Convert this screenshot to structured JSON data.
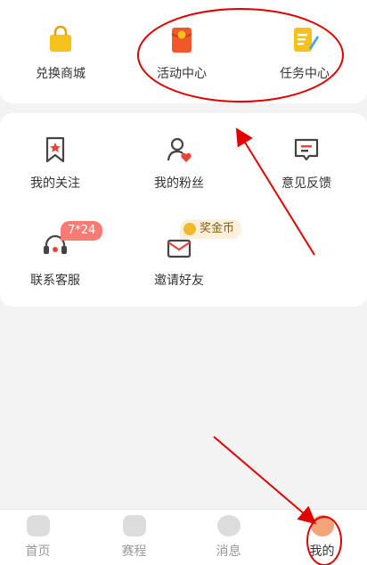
{
  "top_row": [
    {
      "label": "兑换商城",
      "icon": "shopping-bag-icon"
    },
    {
      "label": "活动中心",
      "icon": "red-envelope-icon"
    },
    {
      "label": "任务中心",
      "icon": "task-notepad-icon"
    }
  ],
  "services": [
    {
      "label": "我的关注",
      "icon": "bookmark-star-icon"
    },
    {
      "label": "我的粉丝",
      "icon": "user-heart-icon"
    },
    {
      "label": "意见反馈",
      "icon": "feedback-chat-icon"
    },
    {
      "label": "联系客服",
      "icon": "headset-icon",
      "badge": "7*24"
    },
    {
      "label": "邀请好友",
      "icon": "invite-envelope-icon",
      "badge": "奖金币"
    }
  ],
  "tabbar": [
    {
      "label": "首页",
      "icon": "home-icon"
    },
    {
      "label": "赛程",
      "icon": "trophy-icon"
    },
    {
      "label": "消息",
      "icon": "message-bubble-icon"
    },
    {
      "label": "我的",
      "icon": "profile-avatar-icon",
      "active": true
    }
  ],
  "colors": {
    "accent": "#f26b2c",
    "badge": "#fa7b74",
    "annotation": "#e00000"
  }
}
